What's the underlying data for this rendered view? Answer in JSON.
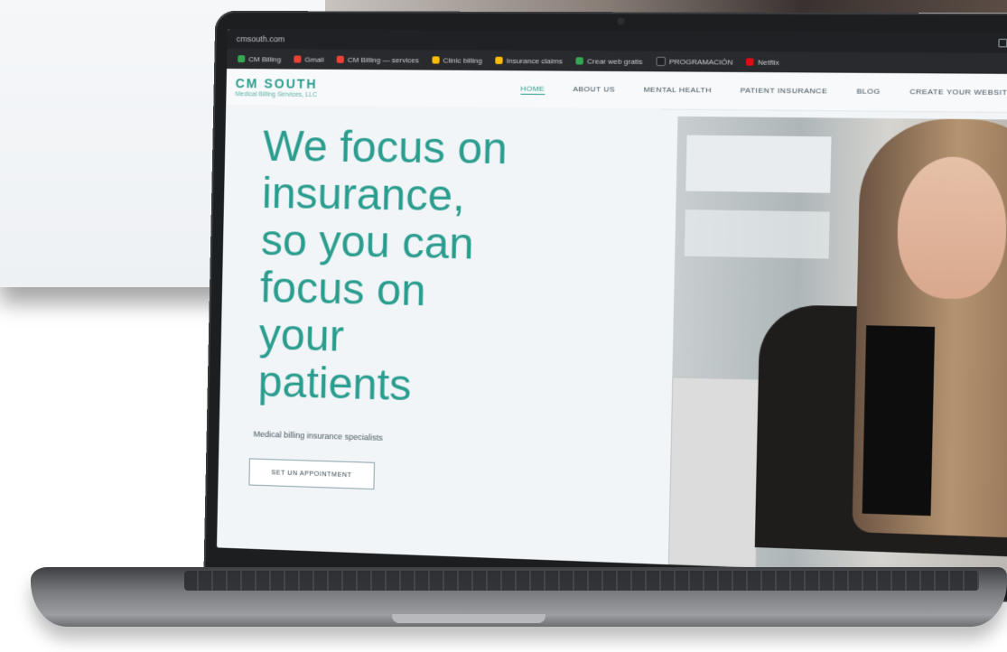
{
  "browser": {
    "url": "cmsouth.com",
    "bookmarks": [
      {
        "label": "CM Billing",
        "color": "#34a853"
      },
      {
        "label": "Gmail",
        "color": "#ea4335"
      },
      {
        "label": "CM Billing — services",
        "color": "#ea4335"
      },
      {
        "label": "Clinic billing",
        "color": "#fbbc04"
      },
      {
        "label": "Insurance claims",
        "color": "#fbbc04"
      },
      {
        "label": "Crear web gratis",
        "color": "#34a853"
      },
      {
        "label": "PROGRAMACIÓN",
        "color": "#202124"
      },
      {
        "label": "Netflix",
        "color": "#e50914"
      }
    ]
  },
  "site": {
    "logo_title": "CM SOUTH",
    "logo_sub": "Medical Billing Services, LLC",
    "nav": [
      {
        "label": "HOME",
        "active": true
      },
      {
        "label": "ABOUT US",
        "active": false
      },
      {
        "label": "MENTAL HEALTH",
        "active": false
      },
      {
        "label": "PATIENT INSURANCE",
        "active": false
      },
      {
        "label": "BLOG",
        "active": false
      },
      {
        "label": "CREATE YOUR WEBSITE",
        "active": false
      }
    ],
    "hero": {
      "headline_lines": [
        "We focus on",
        "insurance,",
        "so you can",
        "focus on",
        "your",
        "patients"
      ],
      "tagline": "Medical billing insurance specialists",
      "cta_label": "SET UN APPOINTMENT"
    }
  },
  "colors": {
    "brand": "#2a9d8f",
    "hero_bg": "#f1f5f7"
  }
}
